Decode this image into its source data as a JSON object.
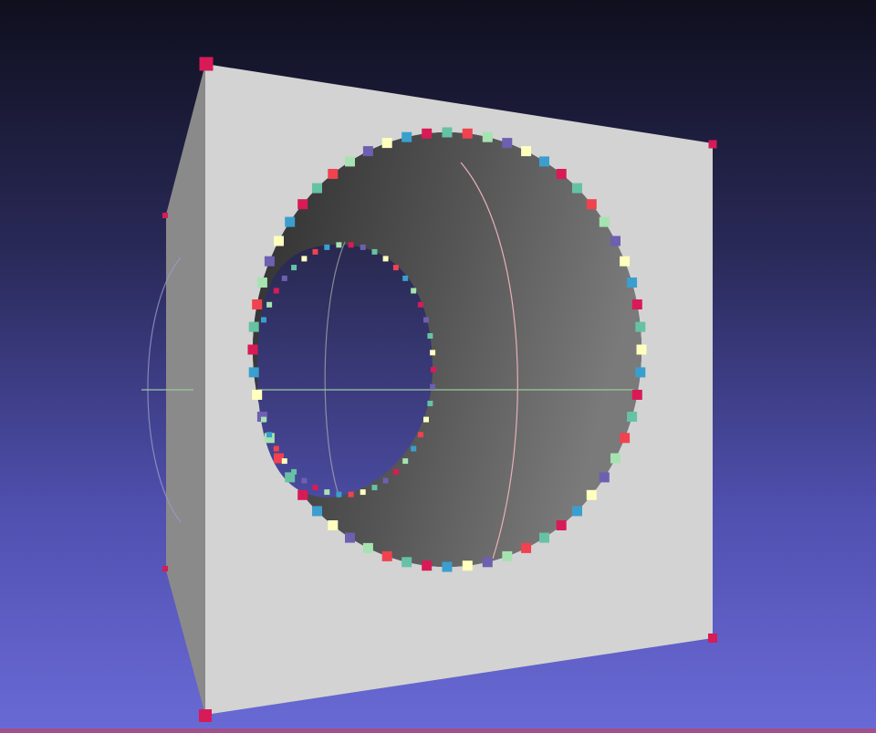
{
  "viewer": {
    "background_top": "#0f0f1e",
    "background_bottom": "#6a6ad6"
  },
  "mesh": {
    "front_face_color": "#d2d2d2",
    "side_face_color": "#8c8c8c",
    "hole_color": "#3a3a3a"
  },
  "marker_palette": [
    "#d81b56",
    "#ffffbe",
    "#a6e3b0",
    "#66c2a5",
    "#3a9fce",
    "#6e5fb0",
    "#f0424f"
  ],
  "icons": {
    "vertex_marker": "square-marker-icon",
    "trackball": "trackball-icon"
  }
}
